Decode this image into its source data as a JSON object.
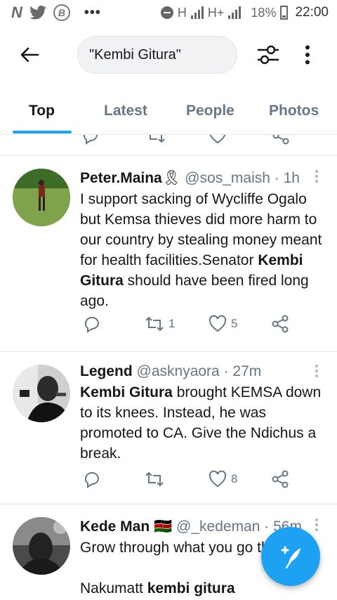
{
  "status_bar": {
    "battery": "18%",
    "time": "22:00",
    "network_1": "H",
    "network_2": "H+"
  },
  "header": {
    "search_value": "\"Kembi Gitura\"",
    "icons": [
      "back-arrow-icon",
      "filter-icon",
      "more-vert-icon"
    ]
  },
  "tabs": [
    {
      "label": "Top",
      "active": true
    },
    {
      "label": "Latest",
      "active": false
    },
    {
      "label": "People",
      "active": false
    },
    {
      "label": "Photos",
      "active": false
    }
  ],
  "tweets": [
    {
      "name": "Peter.Maina",
      "badge": "🎗",
      "handle": "@sos_maish",
      "time": "· 1h",
      "text_segments": [
        {
          "t": "I support sacking of Wycliffe Ogalo but Kemsa thieves did more harm to our country by stealing money meant for health facilities.Senator ",
          "b": false
        },
        {
          "t": "Kembi Gitura",
          "b": true
        },
        {
          "t": " should have been fired long ago.",
          "b": false
        }
      ],
      "replies": "",
      "retweets": "1",
      "likes": "5"
    },
    {
      "name": "Legend",
      "badge": "",
      "handle": "@asknyaora",
      "time": "· 27m",
      "text_segments": [
        {
          "t": "Kembi Gitura",
          "b": true
        },
        {
          "t": " brought KEMSA down to its knees. Instead, he was promoted to CA. Give the Ndichus a break.",
          "b": false
        }
      ],
      "replies": "",
      "retweets": "",
      "likes": "8"
    },
    {
      "name": "Kede Man",
      "badge": "🇰🇪",
      "handle": "@_kedeman",
      "time": "· 56m",
      "text_segments": [
        {
          "t": "Grow through what you go through",
          "b": false
        }
      ],
      "extra_line_segments": [
        {
          "t": "Nakumatt ",
          "b": false
        },
        {
          "t": "kembi gitura",
          "b": true
        }
      ]
    }
  ],
  "colors": {
    "accent": "#1da1f2",
    "secondary_text": "#657786",
    "divider": "#e1e8ed"
  }
}
